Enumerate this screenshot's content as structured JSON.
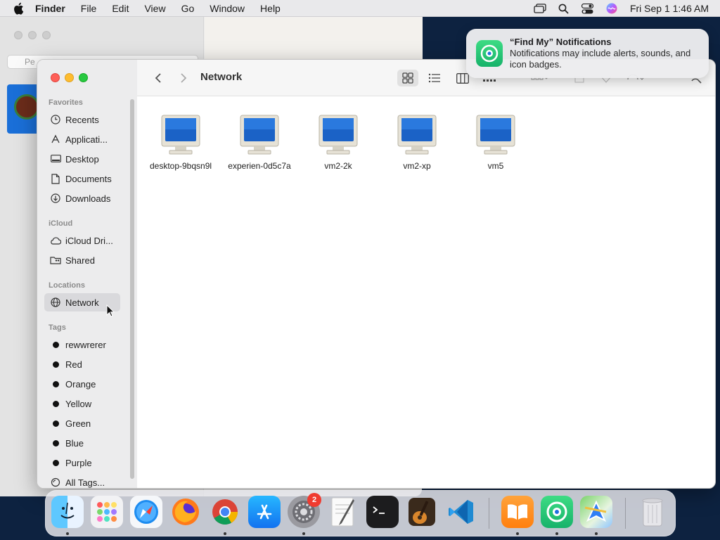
{
  "menubar": {
    "app_name": "Finder",
    "menus": [
      "File",
      "Edit",
      "View",
      "Go",
      "Window",
      "Help"
    ],
    "clock": "Fri Sep 1  1:46 AM"
  },
  "background_window": {
    "field_text": "Pe"
  },
  "finder": {
    "title": "Network",
    "sidebar": {
      "favorites_header": "Favorites",
      "favorites": [
        {
          "label": "Recents",
          "icon": "clock-icon"
        },
        {
          "label": "Applicati...",
          "icon": "applications-icon"
        },
        {
          "label": "Desktop",
          "icon": "desktop-icon"
        },
        {
          "label": "Documents",
          "icon": "document-icon"
        },
        {
          "label": "Downloads",
          "icon": "download-icon"
        }
      ],
      "icloud_header": "iCloud",
      "icloud": [
        {
          "label": "iCloud Dri...",
          "icon": "cloud-icon"
        },
        {
          "label": "Shared",
          "icon": "shared-folder-icon"
        }
      ],
      "locations_header": "Locations",
      "locations": [
        {
          "label": "Network",
          "icon": "globe-icon",
          "selected": true
        }
      ],
      "tags_header": "Tags",
      "tags": [
        {
          "label": "rewwrerer"
        },
        {
          "label": "Red"
        },
        {
          "label": "Orange"
        },
        {
          "label": "Yellow"
        },
        {
          "label": "Green"
        },
        {
          "label": "Blue"
        },
        {
          "label": "Purple"
        }
      ],
      "all_tags": "All Tags..."
    },
    "items": [
      {
        "name": "desktop-9bqsn9l"
      },
      {
        "name": "experien-0d5c7a"
      },
      {
        "name": "vm2-2k"
      },
      {
        "name": "vm2-xp"
      },
      {
        "name": "vm5"
      }
    ]
  },
  "notification": {
    "title": "“Find My” Notifications",
    "body": "Notifications may include alerts, sounds, and icon badges."
  },
  "dock": {
    "settings_badge": "2"
  },
  "colors": {
    "accent": "#1a6fd8",
    "selection": "#d9d9dc",
    "close": "#fe5f57",
    "minimize": "#febc2e",
    "zoom": "#28c840"
  }
}
